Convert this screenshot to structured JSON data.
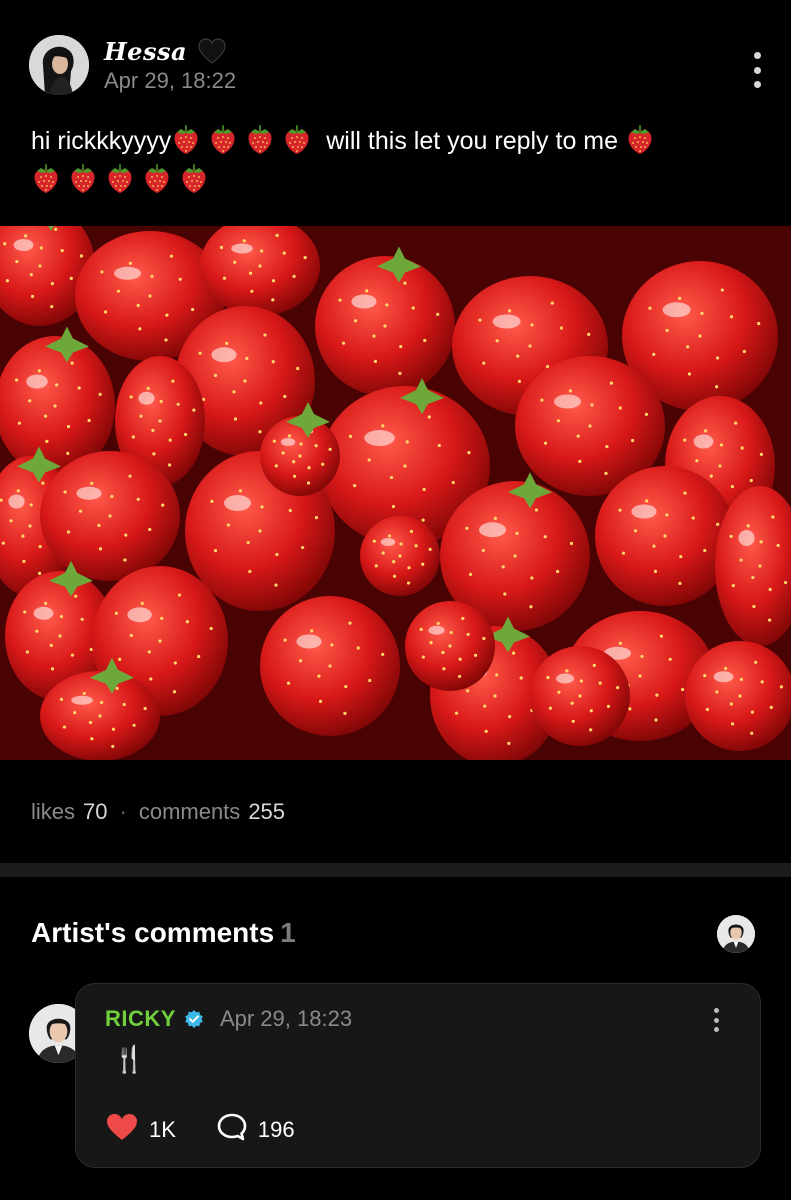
{
  "post": {
    "author": "Hessa",
    "author_badge_icon": "black-heart-icon",
    "date": "Apr 29, 18:22",
    "text_start": "hi rickkkyyyy",
    "text_middle": "will this let you reply to me",
    "image_subject": "strawberries",
    "stats": {
      "likes_label": "likes",
      "likes_count": "70",
      "separator": "·",
      "comments_label": "comments",
      "comments_count": "255"
    }
  },
  "artist_comments": {
    "title": "Artist's comments",
    "count": "1",
    "comment": {
      "name": "RICKY",
      "verified_icon": "verified-badge-icon",
      "date": "Apr 29, 18:23",
      "body": "🍴",
      "like_count": "1K",
      "reply_count": "196"
    }
  },
  "colors": {
    "background": "#000000",
    "artist_name": "#6fcf3c",
    "verified": "#3bb8e8",
    "like_heart": "#ef4a4a",
    "muted_text": "#8a8a8a"
  }
}
